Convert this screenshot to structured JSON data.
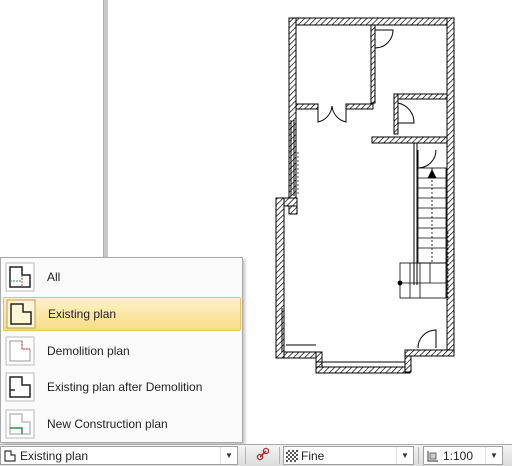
{
  "menu": {
    "items": [
      {
        "label": "All",
        "icon": "all-plans-icon",
        "selected": false
      },
      {
        "label": "Existing plan",
        "icon": "existing-plan-icon",
        "selected": true
      },
      {
        "label": "Demolition plan",
        "icon": "demolition-plan-icon",
        "selected": false
      },
      {
        "label": "Existing plan after Demolition",
        "icon": "existing-after-demolition-icon",
        "selected": false
      },
      {
        "label": "New Construction plan",
        "icon": "new-construction-plan-icon",
        "selected": false
      }
    ]
  },
  "statusbar": {
    "phase_value": "Existing plan",
    "detail_value": "Fine",
    "scale_value": "1:100"
  },
  "colors": {
    "accent_selected": "#f8dc86",
    "demolition_red": "#c0392b",
    "new_green": "#2e8b57"
  }
}
